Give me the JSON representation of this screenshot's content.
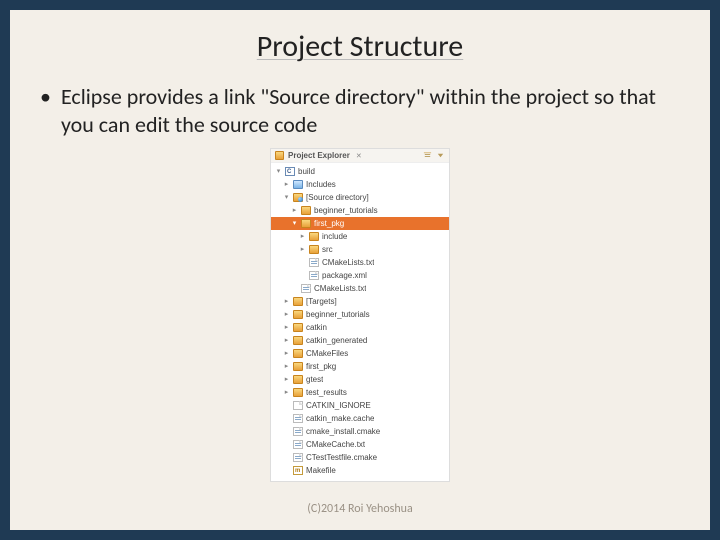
{
  "slide": {
    "title": "Project Structure",
    "bullet": "Eclipse provides a link \"Source directory\" within the project so that you can edit the source code",
    "footer": "(C)2014 Roi Yehoshua"
  },
  "explorer": {
    "tab_label": "Project Explorer",
    "collapse_tooltip": "Collapse All",
    "menu_tooltip": "View Menu"
  },
  "tree": [
    {
      "depth": 0,
      "arrow": "down",
      "icon": "cproj",
      "label": "build",
      "interactable": true
    },
    {
      "depth": 1,
      "arrow": "right",
      "icon": "src",
      "label": "Includes",
      "interactable": true
    },
    {
      "depth": 1,
      "arrow": "down",
      "icon": "folder-shared",
      "label": "[Source directory]",
      "interactable": true
    },
    {
      "depth": 2,
      "arrow": "right",
      "icon": "folder",
      "label": "beginner_tutorials",
      "interactable": true
    },
    {
      "depth": 2,
      "arrow": "down",
      "icon": "folder",
      "label": "first_pkg",
      "interactable": true,
      "selected": true
    },
    {
      "depth": 3,
      "arrow": "right",
      "icon": "folder",
      "label": "include",
      "interactable": true
    },
    {
      "depth": 3,
      "arrow": "right",
      "icon": "folder",
      "label": "src",
      "interactable": true
    },
    {
      "depth": 3,
      "arrow": "none",
      "icon": "file-lines",
      "label": "CMakeLists.txt",
      "interactable": true
    },
    {
      "depth": 3,
      "arrow": "none",
      "icon": "file-lines",
      "label": "package.xml",
      "interactable": true
    },
    {
      "depth": 2,
      "arrow": "none",
      "icon": "file-lines",
      "label": "CMakeLists.txt",
      "interactable": true
    },
    {
      "depth": 1,
      "arrow": "right",
      "icon": "folder",
      "label": "[Targets]",
      "interactable": true
    },
    {
      "depth": 1,
      "arrow": "right",
      "icon": "folder",
      "label": "beginner_tutorials",
      "interactable": true
    },
    {
      "depth": 1,
      "arrow": "right",
      "icon": "folder",
      "label": "catkin",
      "interactable": true
    },
    {
      "depth": 1,
      "arrow": "right",
      "icon": "folder",
      "label": "catkin_generated",
      "interactable": true
    },
    {
      "depth": 1,
      "arrow": "right",
      "icon": "folder",
      "label": "CMakeFiles",
      "interactable": true
    },
    {
      "depth": 1,
      "arrow": "right",
      "icon": "folder",
      "label": "first_pkg",
      "interactable": true
    },
    {
      "depth": 1,
      "arrow": "right",
      "icon": "folder",
      "label": "gtest",
      "interactable": true
    },
    {
      "depth": 1,
      "arrow": "right",
      "icon": "folder",
      "label": "test_results",
      "interactable": true
    },
    {
      "depth": 1,
      "arrow": "none",
      "icon": "file",
      "label": "CATKIN_IGNORE",
      "interactable": true
    },
    {
      "depth": 1,
      "arrow": "none",
      "icon": "file-lines",
      "label": "catkin_make.cache",
      "interactable": true
    },
    {
      "depth": 1,
      "arrow": "none",
      "icon": "file-lines",
      "label": "cmake_install.cmake",
      "interactable": true
    },
    {
      "depth": 1,
      "arrow": "none",
      "icon": "file-lines",
      "label": "CMakeCache.txt",
      "interactable": true
    },
    {
      "depth": 1,
      "arrow": "none",
      "icon": "file-lines",
      "label": "CTestTestfile.cmake",
      "interactable": true
    },
    {
      "depth": 1,
      "arrow": "none",
      "icon": "makefile",
      "label": "Makefile",
      "interactable": true
    }
  ]
}
